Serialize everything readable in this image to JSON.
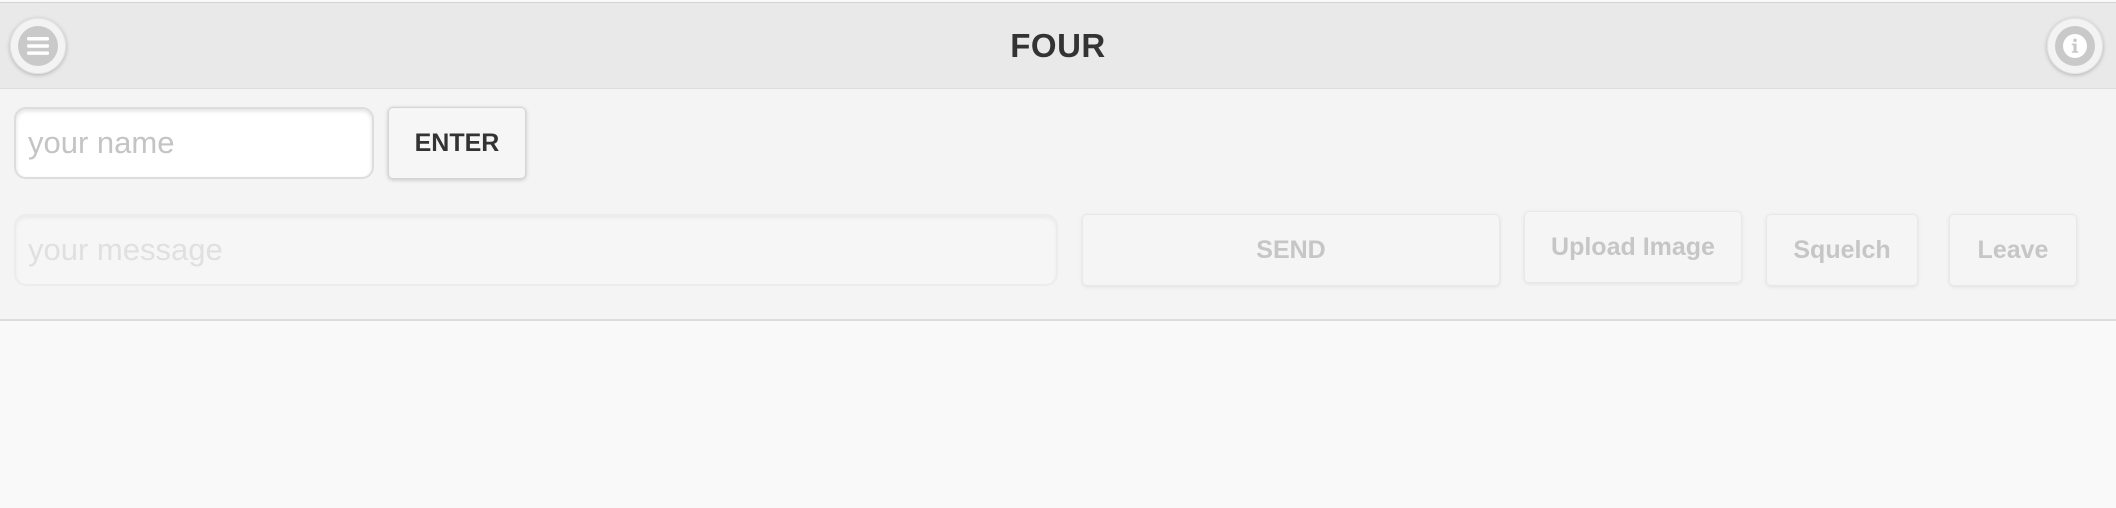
{
  "header": {
    "title": "FOUR",
    "menu_icon": "menu-icon",
    "info_icon": "info-icon"
  },
  "login": {
    "name_placeholder": "your name",
    "name_value": "",
    "enter_label": "ENTER"
  },
  "chat": {
    "message_placeholder": "your message",
    "message_value": "",
    "send_label": "SEND",
    "upload_label": "Upload Image",
    "squelch_label": "Squelch",
    "leave_label": "Leave"
  },
  "colors": {
    "header_bg": "#e9e9e9",
    "toolbar_bg": "#f4f4f4",
    "page_bg": "#f9f9f9",
    "text": "#333333",
    "disabled_text": "#c6c6c6"
  }
}
